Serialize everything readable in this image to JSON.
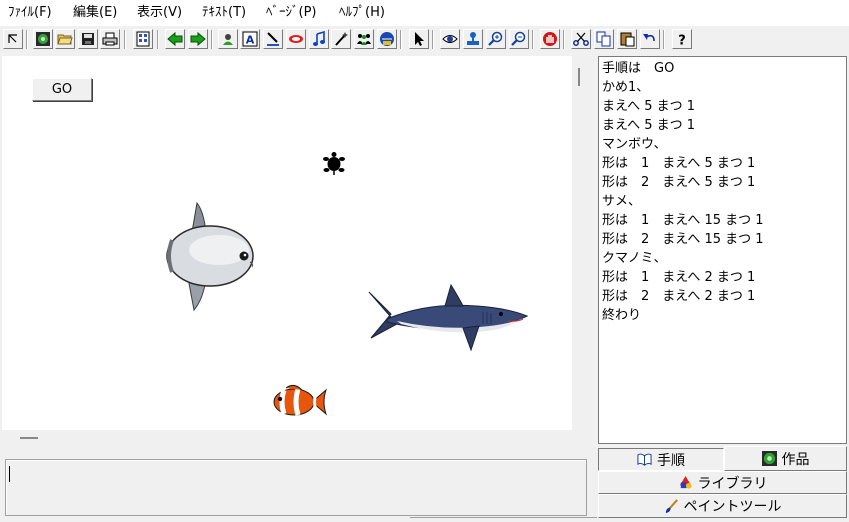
{
  "menu": [
    "ﾌｧｲﾙ(F)",
    "編集(E)",
    "表示(V)",
    "ﾃｷｽﾄ(T)",
    "ﾍﾞｰｼﾞ(P)",
    "ﾍﾙﾌﾟ(H)"
  ],
  "stage": {
    "go_label": "GO"
  },
  "script": {
    "lines": [
      "手順は　GO",
      "かめ1、",
      "まえへ 5 まつ 1",
      "まえへ 5 まつ 1",
      "マンボウ、",
      "形は　1　まえへ 5 まつ 1",
      "形は　2　まえへ 5 まつ 1",
      "サメ、",
      "形は　1　まえへ 15 まつ 1",
      "形は　2　まえへ 15 まつ 1",
      "クマノミ、",
      "形は　1　まえへ 2 まつ 1",
      "形は　2　まえへ 2 まつ 1",
      "終わり"
    ]
  },
  "tabs": {
    "tejun": "手順",
    "sakuhin": "作品",
    "library": "ライブラリ",
    "paint": "ペイントツール"
  },
  "colors": {
    "stage_bg": "#ffffff",
    "window_bg": "#f0f0f0",
    "clownfish": "#e8550c",
    "shark": "#3a4a6e"
  }
}
